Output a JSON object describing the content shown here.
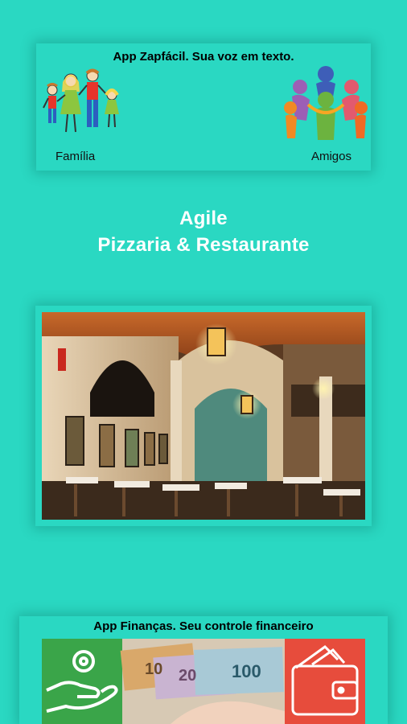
{
  "zap_banner": {
    "title": "App Zapfácil. Sua voz em texto.",
    "family_label": "Família",
    "friends_label": "Amigos"
  },
  "heading": {
    "line1": "Agile",
    "line2": "Pizzaria & Restaurante"
  },
  "finance_banner": {
    "title": "App Finanças. Seu controle financeiro"
  },
  "colors": {
    "background": "#2ad8c2",
    "heading_text": "#ffffff"
  }
}
